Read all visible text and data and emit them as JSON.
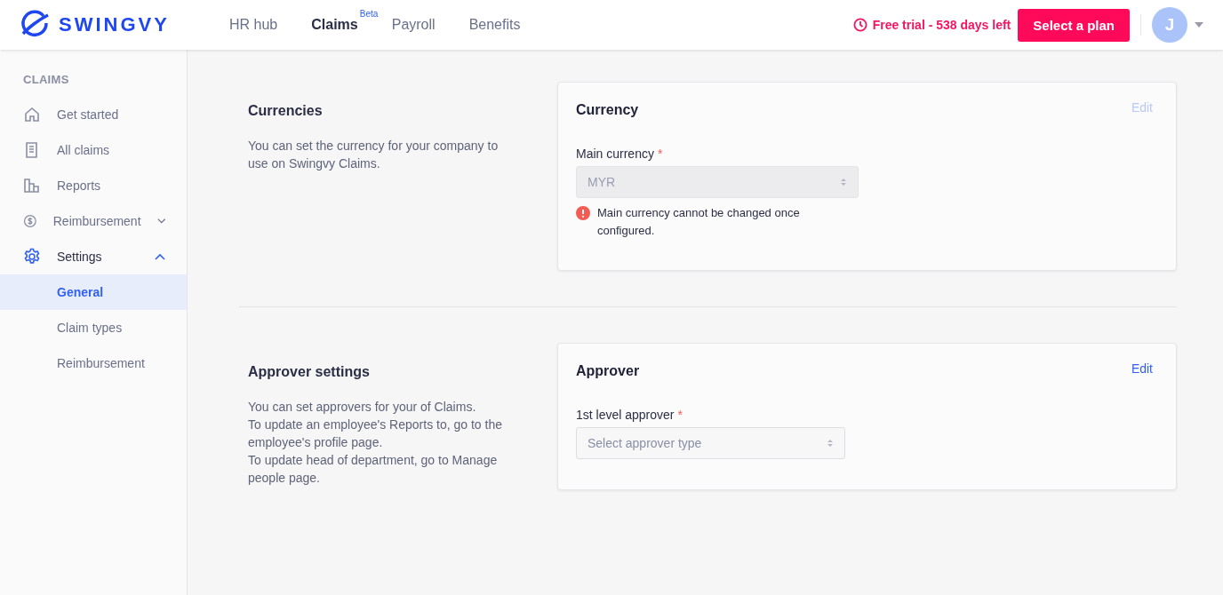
{
  "header": {
    "logo": "SWINGVY",
    "nav": [
      {
        "label": "HR hub",
        "selected": false
      },
      {
        "label": "Claims",
        "selected": true,
        "badge": "Beta"
      },
      {
        "label": "Payroll",
        "selected": false
      },
      {
        "label": "Benefits",
        "selected": false
      }
    ],
    "trial": "Free trial - 538 days left",
    "plan_button": "Select a plan",
    "avatar": "J"
  },
  "sidebar": {
    "heading": "CLAIMS",
    "items": [
      {
        "kind": "link",
        "label": "Get started",
        "selected": false
      },
      {
        "kind": "link",
        "label": "All claims",
        "selected": false
      },
      {
        "kind": "link",
        "label": "Reports",
        "selected": false
      },
      {
        "kind": "group",
        "label": "Reimbursement",
        "selected": false,
        "expanded": false
      },
      {
        "kind": "group",
        "label": "Settings",
        "selected": true,
        "expanded": true,
        "children": [
          {
            "label": "General",
            "selected": true
          },
          {
            "label": "Claim types",
            "selected": false
          },
          {
            "label": "Reimbursement",
            "selected": false
          }
        ]
      }
    ]
  },
  "sections": [
    {
      "title": "Currencies",
      "description": [
        "You can set the currency for your company to use on Swingvy Claims."
      ],
      "card": {
        "title": "Currency",
        "edit": {
          "label": "Edit",
          "disabled": true
        },
        "field": {
          "label": "Main currency",
          "required_mark": "*",
          "value": "MYR",
          "disabled": true,
          "error": "Main currency cannot be changed once configured."
        }
      }
    },
    {
      "title": "Approver settings",
      "description": [
        "You can set approvers for your of Claims.",
        "To update an employee's Reports to, go to the employee's profile page.",
        "To update head of department, go to Manage people page."
      ],
      "card": {
        "title": "Approver",
        "edit": {
          "label": "Edit",
          "disabled": false
        },
        "field": {
          "label": "1st level approver",
          "required_mark": "*",
          "placeholder": "Select approver type",
          "disabled": false
        }
      }
    }
  ]
}
